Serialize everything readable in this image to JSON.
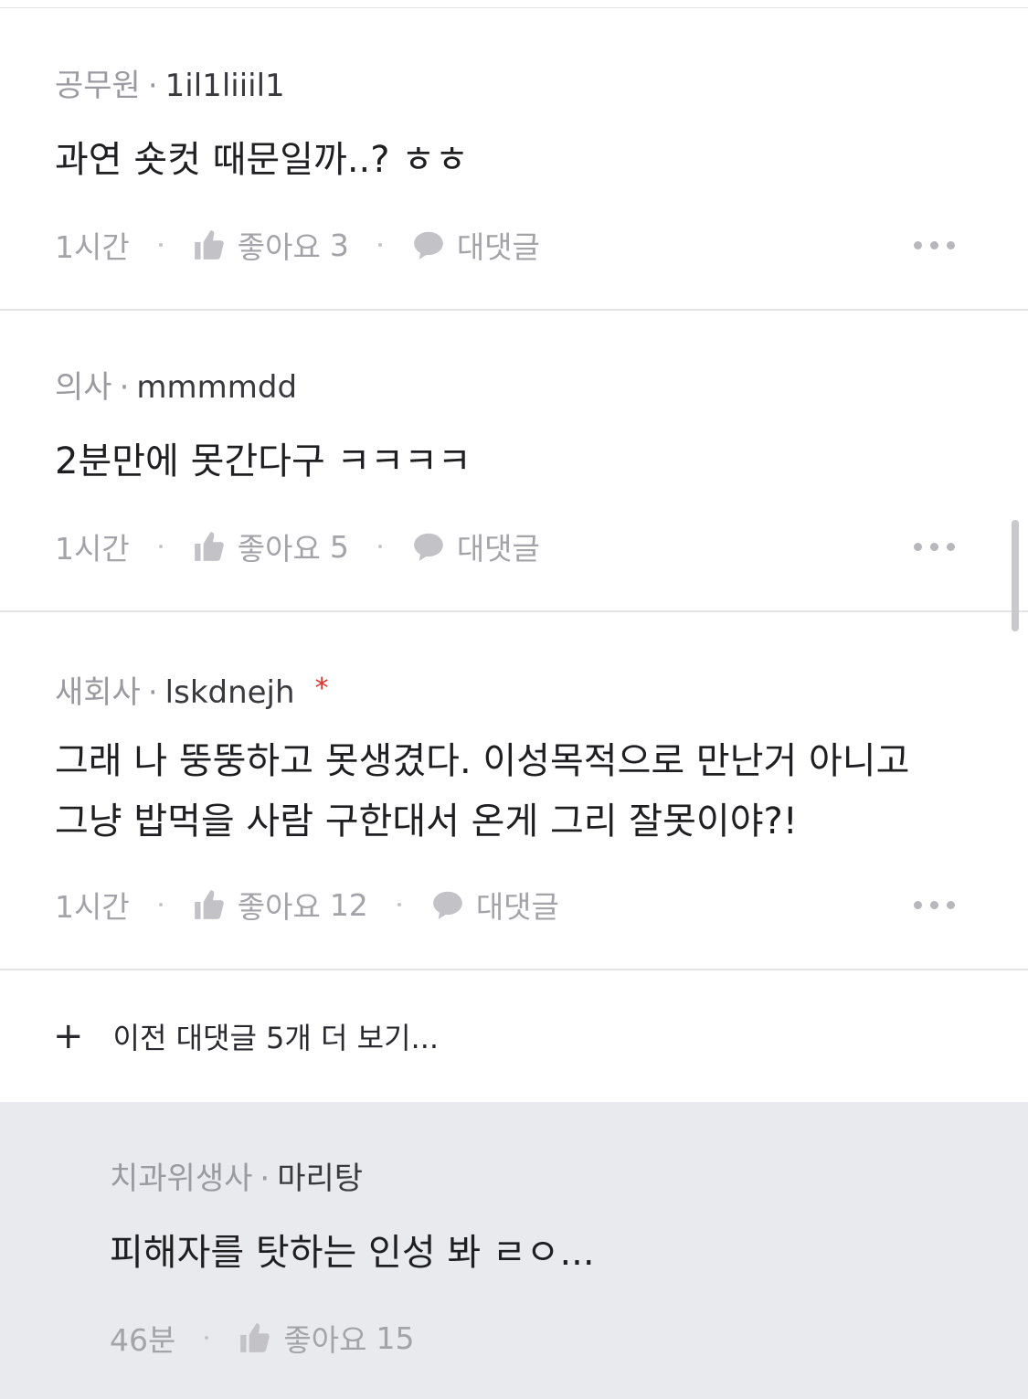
{
  "comments": [
    {
      "job": "공무원",
      "nickname": "1il1liiil1",
      "text": "과연 숏컷 때문일까..? ㅎㅎ",
      "time": "1시간",
      "like_label": "좋아요",
      "likes": "3",
      "reply_label": "대댓글"
    },
    {
      "job": "의사",
      "nickname": "mmmmdd",
      "text": "2분만에 못간다구 ㅋㅋㅋㅋ",
      "time": "1시간",
      "like_label": "좋아요",
      "likes": "5",
      "reply_label": "대댓글"
    },
    {
      "job": "새회사",
      "nickname": "lskdnejh",
      "flag": "*",
      "text": "그래 나 뚱뚱하고 못생겼다. 이성목적으로 만난거 아니고\n그냥 밥먹을 사람 구한대서 온게 그리 잘못이야?!",
      "time": "1시간",
      "like_label": "좋아요",
      "likes": "12",
      "reply_label": "대댓글"
    }
  ],
  "load_more": {
    "icon": "plus-icon",
    "label": "이전 대댓글 5개 더 보기..."
  },
  "reply": {
    "job": "치과위생사",
    "nickname": "마리탕",
    "text": "피해자를 탓하는 인성 봐 ㄹㅇ...",
    "time": "46분",
    "like_label": "좋아요",
    "likes": "15"
  },
  "colors": {
    "reply_background": "#e9eaee",
    "flag_red": "#e0322f",
    "muted_text": "#a3a3a8"
  }
}
